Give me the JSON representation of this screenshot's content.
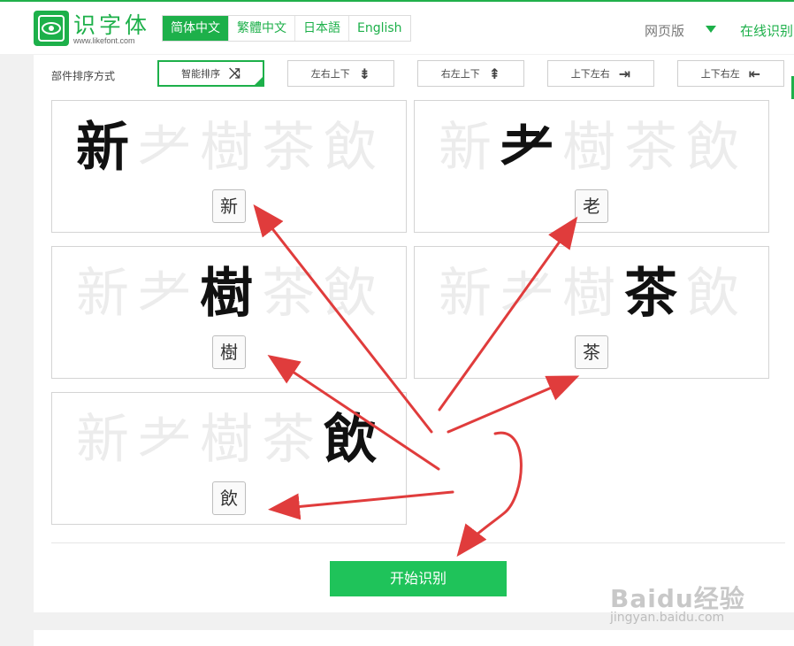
{
  "header": {
    "logo_text": "识字体",
    "logo_url": "www.likefont.com",
    "lang_tabs": [
      "简体中文",
      "繁體中文",
      "日本語",
      "English"
    ],
    "active_lang": "简体中文",
    "web_version": "网页版",
    "online_recognize": "在线识别"
  },
  "sort": {
    "label": "部件排序方式",
    "buttons": [
      {
        "label": "智能排序",
        "icon": "shuffle-icon",
        "glyph": "⤨"
      },
      {
        "label": "左右上下",
        "icon": "sort-lr-tb-icon",
        "glyph": "⇟"
      },
      {
        "label": "右左上下",
        "icon": "sort-rl-tb-icon",
        "glyph": "⇞"
      },
      {
        "label": "上下左右",
        "icon": "sort-tb-lr-icon",
        "glyph": "⇥"
      },
      {
        "label": "上下右左",
        "icon": "sort-tb-rl-icon",
        "glyph": "⇤"
      }
    ],
    "active": "智能排序"
  },
  "glyph_row": [
    "新",
    "耂",
    "樹",
    "茶",
    "飲"
  ],
  "cards": [
    {
      "highlight": 0,
      "answer": "新"
    },
    {
      "highlight": 1,
      "answer": "老"
    },
    {
      "highlight": 2,
      "answer": "樹"
    },
    {
      "highlight": 3,
      "answer": "茶"
    },
    {
      "highlight": 4,
      "answer": "飲"
    }
  ],
  "start_button": "开始识别",
  "watermark": {
    "brand": "Baidu经验",
    "url": "jingyan.baidu.com"
  },
  "colors": {
    "accent": "#1db04a",
    "button": "#1fc35a",
    "arrow": "#e03c3c"
  }
}
